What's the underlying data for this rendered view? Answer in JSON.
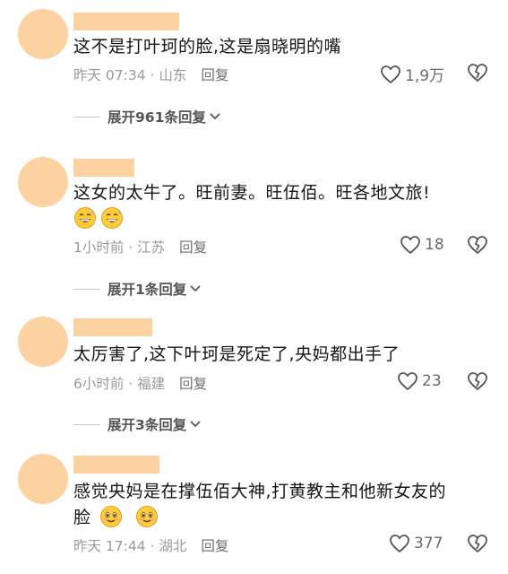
{
  "comments": [
    {
      "text": "这不是打叶珂的脸,这是扇晓明的嘴",
      "time": "昨天 07:34 · 山东",
      "reply": "回复",
      "likes": "1,9万",
      "expand": "展开961条回复"
    },
    {
      "text": "这女的太牛了。旺前妻。旺伍佰。旺各地文旅!",
      "emoji_row": [
        "grin-sweat-emoji",
        "grin-sweat-emoji"
      ],
      "time": "1小时前 · 江苏",
      "reply": "回复",
      "likes": "18",
      "expand": "展开1条回复"
    },
    {
      "text": "太厉害了,这下叶珂是死定了,央妈都出手了",
      "time": "6小时前 · 福建",
      "reply": "回复",
      "likes": "23",
      "expand": "展开3条回复"
    },
    {
      "text": "感觉央妈是在撑伍佰大神,打黄教主和他新女友的",
      "text_line2": "脸",
      "emoji_row": [
        "smiling-emoji",
        "smiling-emoji"
      ],
      "time": "昨天 17:44 · 湖北",
      "reply": "回复",
      "likes": "377"
    }
  ],
  "colors": {
    "avatar": "#fcd3a0",
    "text": "#151515",
    "meta": "#9a9a9a"
  }
}
